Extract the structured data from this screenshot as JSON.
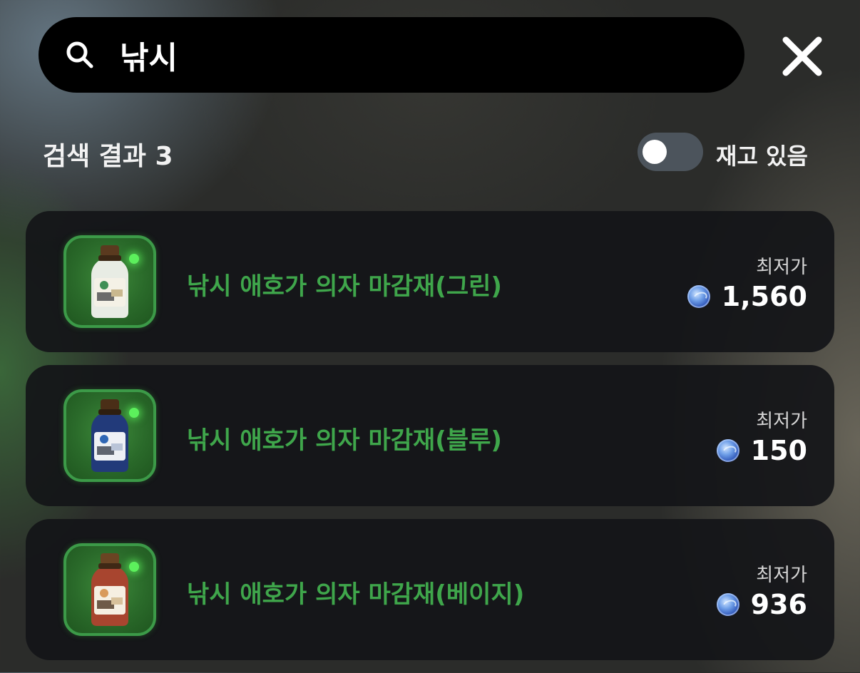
{
  "search": {
    "query": "낚시",
    "search_icon": "search-icon",
    "close_icon": "close-icon"
  },
  "results_header": {
    "label": "검색 결과 3",
    "in_stock_toggle": {
      "label": "재고 있음",
      "checked": false
    }
  },
  "results": [
    {
      "name": "낚시 애호가 의자 마감재(그린)",
      "price_label": "최저가",
      "price": "1,560",
      "jar_label_color": "#3e8f55",
      "jar_body_color": "#e8ece4"
    },
    {
      "name": "낚시 애호가 의자 마감재(블루)",
      "price_label": "최저가",
      "price": "150",
      "jar_label_color": "#2f66b5",
      "jar_body_color": "#223a7a"
    },
    {
      "name": "낚시 애호가 의자 마감재(베이지)",
      "price_label": "최저가",
      "price": "936",
      "jar_label_color": "#d99a5b",
      "jar_body_color": "#a8452f"
    }
  ],
  "colors": {
    "item_name": "#3fa64b",
    "thumb_border": "#3c9a48",
    "currency_icon": "#2f56b8"
  }
}
